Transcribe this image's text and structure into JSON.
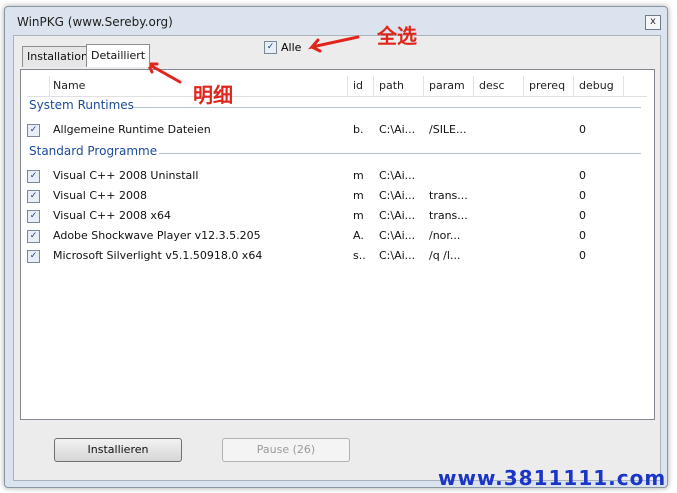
{
  "window": {
    "title": "WinPKG (www.Sereby.org)",
    "close_glyph": "x"
  },
  "tabs": [
    {
      "label": "Installation"
    },
    {
      "label": "Detailliert"
    }
  ],
  "alle": {
    "label": "Alle",
    "checked": true
  },
  "columns": [
    "Name",
    "id",
    "path",
    "param",
    "desc",
    "prereq",
    "debug"
  ],
  "groups": [
    {
      "label": "System Runtimes",
      "rows": [
        {
          "name": "Allgemeine Runtime Dateien",
          "id": "b.",
          "path": "C:\\Ai...",
          "param": "/SILE...",
          "desc": "",
          "prereq": "",
          "debug": "0",
          "checked": true
        }
      ]
    },
    {
      "label": "Standard Programme",
      "rows": [
        {
          "name": "Visual C++ 2008 Uninstall",
          "id": "m",
          "path": "C:\\Ai...",
          "param": "",
          "desc": "",
          "prereq": "",
          "debug": "0",
          "checked": true
        },
        {
          "name": "Visual C++ 2008",
          "id": "m",
          "path": "C:\\Ai...",
          "param": "trans...",
          "desc": "",
          "prereq": "",
          "debug": "0",
          "checked": true
        },
        {
          "name": "Visual C++ 2008 x64",
          "id": "m",
          "path": "C:\\Ai...",
          "param": "trans...",
          "desc": "",
          "prereq": "",
          "debug": "0",
          "checked": true
        },
        {
          "name": "Adobe Shockwave Player v12.3.5.205",
          "id": "A.",
          "path": "C:\\Ai...",
          "param": "/nor...",
          "desc": "",
          "prereq": "",
          "debug": "0",
          "checked": true
        },
        {
          "name": "Microsoft Silverlight v5.1.50918.0 x64",
          "id": "s..",
          "path": "C:\\Ai...",
          "param": "/q /l...",
          "desc": "",
          "prereq": "",
          "debug": "0",
          "checked": true
        }
      ]
    }
  ],
  "buttons": {
    "install": "Installieren",
    "pause": "Pause (26)"
  },
  "annotations": {
    "select_all": "全选",
    "detail": "明细"
  },
  "watermark": "www.3811111.com",
  "check_glyph": "✓",
  "colors": {
    "annotation": "#e0261c",
    "group_text": "#1c4a9c",
    "watermark": "#1a35c8"
  }
}
